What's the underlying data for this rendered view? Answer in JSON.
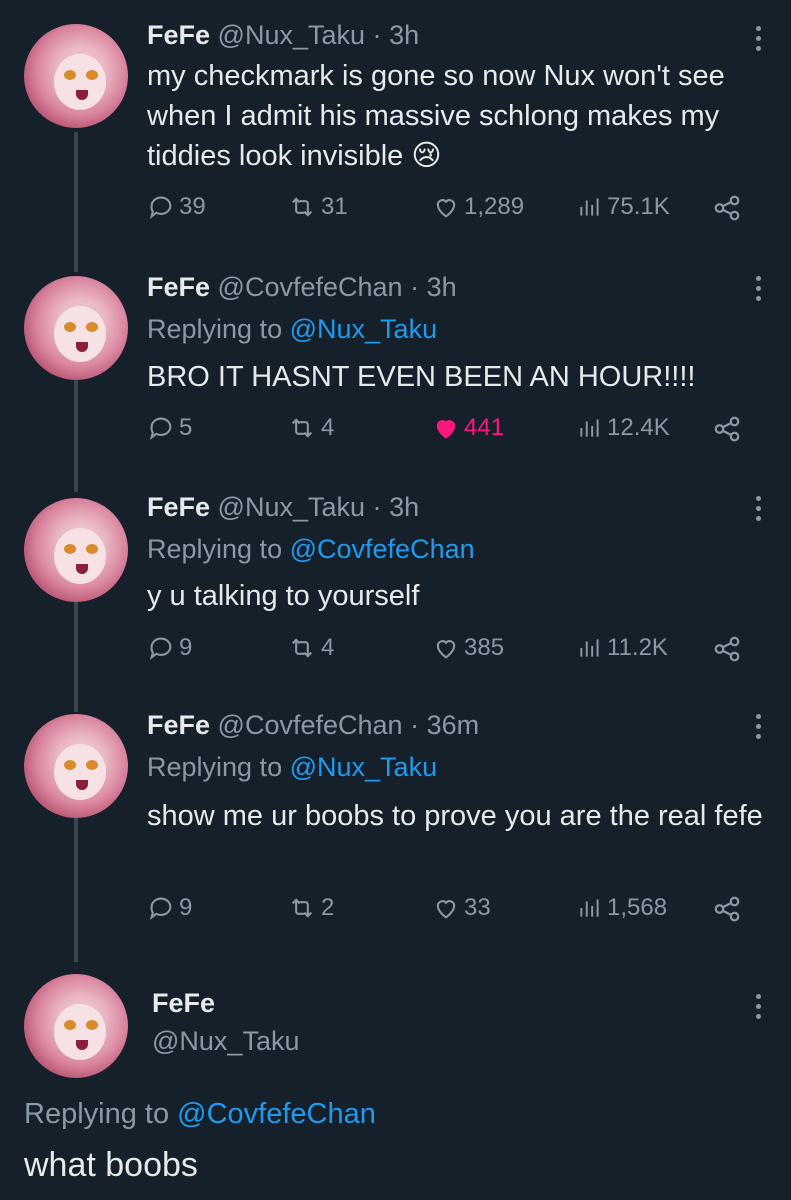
{
  "tweets": [
    {
      "name": "FeFe",
      "handle": "@Nux_Taku",
      "time": "3h",
      "replying_label": "",
      "replying_to": "",
      "text": "my checkmark is gone so now Nux won't see when I admit his massive schlong makes my tiddies look invisible",
      "emoji": "😢",
      "replies": "39",
      "retweets": "31",
      "likes": "1,289",
      "liked": false,
      "views": "75.1K"
    },
    {
      "name": "FeFe",
      "handle": "@CovfefeChan",
      "time": "3h",
      "replying_label": "Replying to",
      "replying_to": "@Nux_Taku",
      "text": "BRO IT HASNT EVEN BEEN AN HOUR!!!!",
      "replies": "5",
      "retweets": "4",
      "likes": "441",
      "liked": true,
      "views": "12.4K"
    },
    {
      "name": "FeFe",
      "handle": "@Nux_Taku",
      "time": "3h",
      "replying_label": "Replying to",
      "replying_to": "@CovfefeChan",
      "text": "y u talking to yourself",
      "replies": "9",
      "retweets": "4",
      "likes": "385",
      "liked": false,
      "views": "11.2K"
    },
    {
      "name": "FeFe",
      "handle": "@CovfefeChan",
      "time": "36m",
      "replying_label": "Replying to",
      "replying_to": "@Nux_Taku",
      "text": "show me ur boobs to prove you are the real fefe",
      "replies": "9",
      "retweets": "2",
      "likes": "33",
      "liked": false,
      "views": "1,568"
    }
  ],
  "focused": {
    "name": "FeFe",
    "handle": "@Nux_Taku",
    "replying_label": "Replying to",
    "replying_to": "@CovfefeChan",
    "text": "what boobs"
  },
  "colors": {
    "background": "#15202b",
    "text": "#e7e9ea",
    "secondary": "#8b98a5",
    "link": "#1d9bf0",
    "like": "#f91880"
  },
  "icons": [
    "more-icon",
    "reply-icon",
    "retweet-icon",
    "like-icon",
    "views-icon",
    "share-icon"
  ]
}
